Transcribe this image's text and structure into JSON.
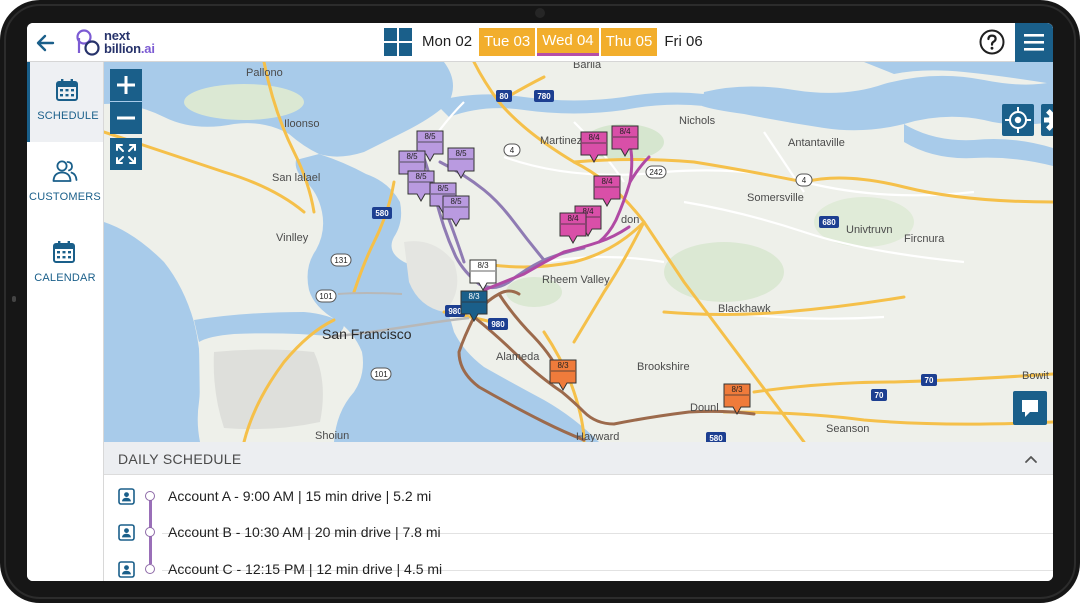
{
  "app": {
    "logo_line1": "next",
    "logo_line2": "billion",
    "logo_suffix": ".ai"
  },
  "header": {
    "days": [
      {
        "label": "Mon 02",
        "highlighted": false,
        "active": false
      },
      {
        "label": "Tue 03",
        "highlighted": true,
        "active": false
      },
      {
        "label": "Wed 04",
        "highlighted": true,
        "active": true
      },
      {
        "label": "Thu 05",
        "highlighted": true,
        "active": false
      },
      {
        "label": "Fri 06",
        "highlighted": false,
        "active": false
      }
    ],
    "help_icon": "question-circle-icon",
    "menu_icon": "hamburger-icon"
  },
  "sidebar": {
    "items": [
      {
        "label": "SCHEDULE",
        "icon": "calendar-icon",
        "active": true
      },
      {
        "label": "CUSTOMERS",
        "icon": "people-icon",
        "active": false
      },
      {
        "label": "CALENDAR",
        "icon": "calendar-icon",
        "active": false
      }
    ]
  },
  "map": {
    "labels": {
      "pallono": "Pallono",
      "barila": "Barila",
      "iloonso": "Iloonso",
      "martinez": "Martinez",
      "nichols": "Nichols",
      "antantaville": "Antantaville",
      "san_lalael": "San lalael",
      "somersville": "Somersville",
      "vinlley": "Vinlley",
      "univtruvn": "Univtruvn",
      "fircnura": "Fircnura",
      "rheem_valley": "Rheem Valley",
      "blackhawk": "Blackhawk",
      "san_francisco": "San Francisco",
      "alameda": "Alameda",
      "brookshire": "Brookshire",
      "dounl": "Dounl",
      "seanson": "Seanson",
      "hayward": "Hayward",
      "shoiun": "Shoiun",
      "bowit": "Bowit",
      "don": "don"
    },
    "route_shields": [
      "80",
      "780",
      "4",
      "242",
      "4",
      "680",
      "580",
      "131",
      "101",
      "101",
      "980",
      "980",
      "70",
      "70",
      "580"
    ],
    "pins": [
      {
        "label": "8/5",
        "color": "#b99ae0"
      },
      {
        "label": "8/5",
        "color": "#b99ae0"
      },
      {
        "label": "8/5",
        "color": "#b99ae0"
      },
      {
        "label": "8/5",
        "color": "#b99ae0"
      },
      {
        "label": "8/5",
        "color": "#b99ae0"
      },
      {
        "label": "8/5",
        "color": "#b99ae0"
      },
      {
        "label": "8/4",
        "color": "#d94fa8"
      },
      {
        "label": "8/4",
        "color": "#d94fa8"
      },
      {
        "label": "8/4",
        "color": "#d94fa8"
      },
      {
        "label": "8/4",
        "color": "#d94fa8"
      },
      {
        "label": "8/4",
        "color": "#d94fa8"
      },
      {
        "label": "8/3",
        "color": "#ffffff"
      },
      {
        "label": "8/3",
        "color": "#1a5f8a"
      },
      {
        "label": "8/3",
        "color": "#ef7b3b"
      },
      {
        "label": "8/3",
        "color": "#ef7b3b"
      }
    ],
    "zoom_in_icon": "plus-icon",
    "zoom_out_icon": "minus-icon",
    "fullscreen_icon": "expand-icon",
    "locate_icon": "crosshair-icon",
    "settings_icon": "gear-icon",
    "chat_icon": "chat-bubble-icon"
  },
  "schedule": {
    "title": "DAILY SCHEDULE",
    "collapse_icon": "chevron-up-icon",
    "rows": [
      {
        "text": "Account A - 9:00 AM | 15 min drive | 5.2 mi"
      },
      {
        "text": "Account B - 10:30 AM | 20 min drive | 7.8 mi"
      },
      {
        "text": "Account C - 12:15 PM | 12 min drive | 4.5 mi"
      }
    ]
  },
  "colors": {
    "primary": "#1a5f8a",
    "day_highlight": "#f2ae2c",
    "active_underline": "#b54fa7",
    "water": "#a8cbea",
    "land": "#eef0ea",
    "highway": "#f5c04a"
  }
}
